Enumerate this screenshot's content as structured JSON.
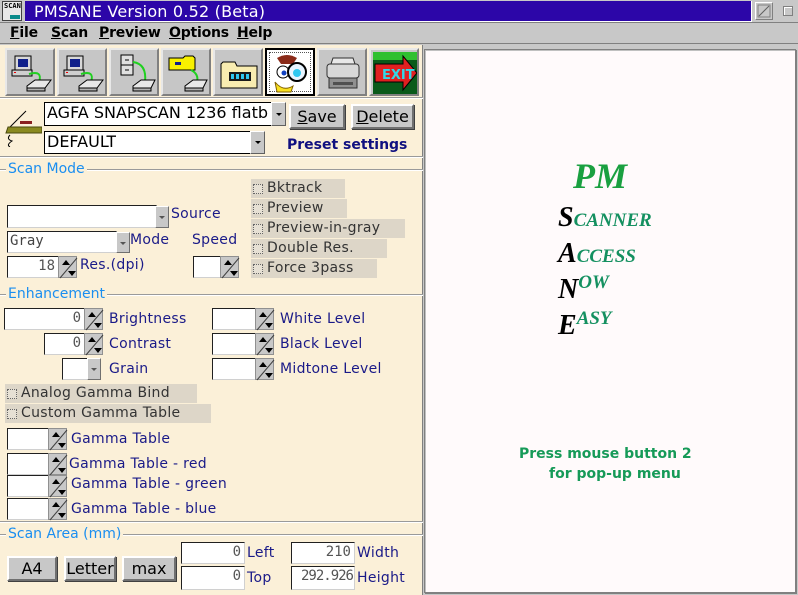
{
  "window": {
    "title": "PMSANE Version 0.52 (Beta)",
    "app_icon_text": "SCAN"
  },
  "menu": {
    "items": [
      {
        "label": "File",
        "mnemonic": "F",
        "rest": "ile"
      },
      {
        "label": "Scan",
        "mnemonic": "S",
        "rest": "can"
      },
      {
        "label": "Preview",
        "mnemonic": "P",
        "rest": "review"
      },
      {
        "label": "Options",
        "mnemonic": "O",
        "rest": "ptions"
      },
      {
        "label": "Help",
        "mnemonic": "H",
        "rest": "elp"
      }
    ]
  },
  "toolbar": {
    "buttons": [
      {
        "name": "scan-to-computer",
        "icon": "computer-scanner-icon"
      },
      {
        "name": "preview-to-computer",
        "icon": "computer-scanner-icon"
      },
      {
        "name": "scan-to-file",
        "icon": "cabinet-scanner-icon"
      },
      {
        "name": "scan-to-folder",
        "icon": "folder-scanner-icon"
      },
      {
        "name": "open-film-folder",
        "icon": "film-folder-icon"
      },
      {
        "name": "viewer",
        "icon": "magnifier-character-icon",
        "active": true
      },
      {
        "name": "print",
        "icon": "printer-icon"
      },
      {
        "name": "exit",
        "icon": "exit-icon",
        "label": "EXIT"
      }
    ]
  },
  "device": {
    "scanner_value": "AGFA SNAPSCAN 1236 flatb",
    "preset_value": "DEFAULT",
    "save_label": {
      "mnemonic": "S",
      "rest": "ave"
    },
    "delete_label": {
      "mnemonic": "D",
      "rest": "elete"
    },
    "preset_settings_label": "Preset settings"
  },
  "scan_mode": {
    "title": "Scan Mode",
    "source_value": "",
    "source_label": "Source",
    "mode_value": "Gray",
    "mode_label": "Mode",
    "speed_label": "Speed",
    "speed_value": "",
    "resolution_value": "18",
    "resolution_label": "Res.(dpi)",
    "checkboxes": [
      {
        "label": "Bktrack",
        "checked": false,
        "enabled": false
      },
      {
        "label": "Preview",
        "checked": false,
        "enabled": false
      },
      {
        "label": "Preview-in-gray",
        "checked": false,
        "enabled": false
      },
      {
        "label": "Double Res.",
        "checked": false,
        "enabled": false
      },
      {
        "label": "Force 3pass",
        "checked": false,
        "enabled": false
      }
    ]
  },
  "enhancement": {
    "title": "Enhancement",
    "brightness_value": "0",
    "brightness_label": "Brightness",
    "contrast_value": "0",
    "contrast_label": "Contrast",
    "grain_value": "",
    "grain_label": "Grain",
    "white_level_value": "",
    "white_level_label": "White Level",
    "black_level_value": "",
    "black_level_label": "Black Level",
    "midtone_level_value": "",
    "midtone_level_label": "Midtone Level",
    "analog_gamma_bind": {
      "label": "Analog Gamma Bind",
      "checked": false
    },
    "custom_gamma_table": {
      "label": "Custom Gamma Table",
      "checked": false
    },
    "gamma_tables": [
      {
        "label": "Gamma Table",
        "value": ""
      },
      {
        "label": "Gamma Table - red",
        "value": ""
      },
      {
        "label": "Gamma Table - green",
        "value": ""
      },
      {
        "label": "Gamma Table - blue",
        "value": ""
      }
    ]
  },
  "scan_area": {
    "title": "Scan Area (mm)",
    "presets": [
      "A4",
      "Letter",
      "max"
    ],
    "left_value": "0",
    "left_label": "Left",
    "top_value": "0",
    "top_label": "Top",
    "width_value": "210",
    "width_label": "Width",
    "height_value": "292.926",
    "height_label": "Height"
  },
  "viewer": {
    "logo_title": "PM",
    "logo_lines": [
      {
        "initial": "S",
        "rest": "CANNER"
      },
      {
        "initial": "A",
        "rest": "CCESS"
      },
      {
        "initial": "N",
        "rest": "OW"
      },
      {
        "initial": "E",
        "rest": "ASY"
      }
    ],
    "hint_line1": "Press mouse button 2",
    "hint_line2": "for pop-up menu"
  },
  "colors": {
    "titlebar": "#2c06a8",
    "panel_bg": "#fbf0d8",
    "group_title": "#1a8ef0",
    "label_text": "#1a1a88",
    "logo_green": "#1aa040",
    "hint_green": "#169a58"
  }
}
